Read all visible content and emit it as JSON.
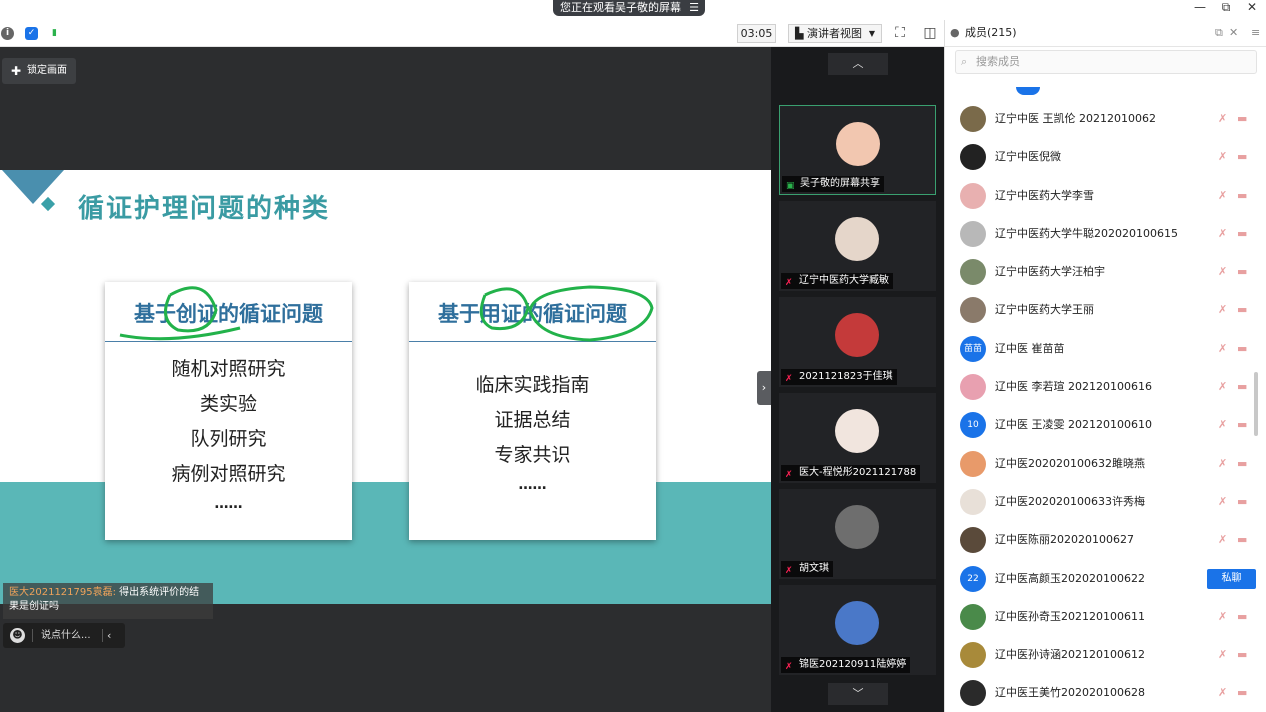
{
  "titlebar": {
    "share_banner": "您正在观看吴子敬的屏幕",
    "menu_glyph": "☰",
    "minimize": "—",
    "restore": "⧉",
    "close": "✕"
  },
  "toolbar": {
    "timer": "03:05",
    "view_mode": "演讲者视图",
    "view_caret": "▼",
    "fullscreen_glyph": "⛶",
    "panel_glyph": "◫"
  },
  "main": {
    "lock_label": "锁定画面",
    "pin_glyph": "📌",
    "slide": {
      "title": "循证护理问题的种类",
      "card_left": {
        "title": "基于创证的循证问题",
        "items": [
          "随机对照研究",
          "类实验",
          "队列研究",
          "病例对照研究",
          "……"
        ]
      },
      "card_right": {
        "title": "基于用证的循证问题",
        "items": [
          "临床实践指南",
          "证据总结",
          "专家共识",
          "……"
        ]
      }
    },
    "chat": {
      "sender": "医大2021121795袁磊:",
      "message_line1": " 得出系统评价的结",
      "message_line2": "果是创证吗",
      "input_placeholder": "说点什么...",
      "emoji_glyph": "☻",
      "collapse_glyph": "‹"
    },
    "collapse_handle_glyph": "›"
  },
  "video_strip": {
    "up_glyph": "︿",
    "down_glyph": "﹀",
    "tiles": [
      {
        "name": "吴子敬的屏幕共享",
        "color": "#f2c7b0"
      },
      {
        "name": "辽宁中医药大学臧敏",
        "color": "#e5d6ca"
      },
      {
        "name": "2021121823于佳琪",
        "color": "#c43a3a"
      },
      {
        "name": "医大-程悦彤2021121788",
        "color": "#f1e5de"
      },
      {
        "name": "胡文琪",
        "color": "#6e6e6e"
      },
      {
        "name": "锦医202120911陆婷婷",
        "color": "#4a78c8"
      }
    ]
  },
  "members": {
    "title": "成员(215)",
    "search_placeholder": "搜索成员",
    "popout_glyph": "⧉",
    "close_glyph": "✕",
    "menu_glyph": "≡",
    "mic_glyph": "✗",
    "cam_glyph": "▬",
    "dm_label": "私聊",
    "list": [
      {
        "name": "辽宁中医 王凯伦 20212010062",
        "avatar": "",
        "color": "#7a6a4a"
      },
      {
        "name": "辽宁中医倪微",
        "avatar": "",
        "color": "#222222"
      },
      {
        "name": "辽宁中医药大学李雪",
        "avatar": "",
        "color": "#e8b0b0"
      },
      {
        "name": "辽宁中医药大学牛聪202020100615",
        "avatar": "",
        "color": "#b8b8b8"
      },
      {
        "name": "辽宁中医药大学汪柏宇",
        "avatar": "",
        "color": "#7a8a6a"
      },
      {
        "name": "辽宁中医药大学王丽",
        "avatar": "",
        "color": "#8a7a6a"
      },
      {
        "name": "辽中医 崔苗苗",
        "avatar": "苗苗",
        "color": "#1a73e8"
      },
      {
        "name": "辽中医 李若瑄 202120100616",
        "avatar": "",
        "color": "#e8a0b0"
      },
      {
        "name": "辽中医 王凌雯 202120100610",
        "avatar": "10",
        "color": "#1a73e8"
      },
      {
        "name": "辽中医202020100632雎晓燕",
        "avatar": "",
        "color": "#e89a6a"
      },
      {
        "name": "辽中医202020100633许秀梅",
        "avatar": "",
        "color": "#e8e0d8"
      },
      {
        "name": "辽中医陈丽202020100627",
        "avatar": "",
        "color": "#5a4a3a"
      },
      {
        "name": "辽中医高颜玉202020100622",
        "avatar": "22",
        "color": "#1a73e8"
      },
      {
        "name": "辽中医孙奇玉202120100611",
        "avatar": "",
        "color": "#4a8a4a"
      },
      {
        "name": "辽中医孙诗涵202120100612",
        "avatar": "",
        "color": "#a88a3a"
      },
      {
        "name": "辽中医王美竹202020100628",
        "avatar": "",
        "color": "#2a2a2a"
      }
    ]
  }
}
